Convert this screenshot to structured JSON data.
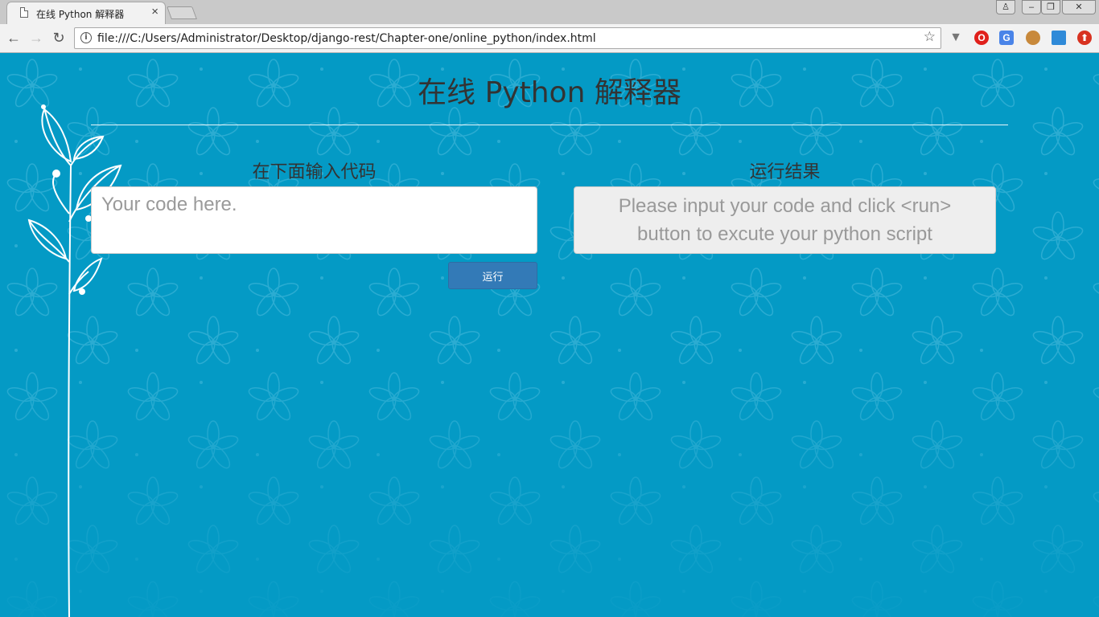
{
  "browser": {
    "tab_title": "在线 Python 解释器",
    "tab_close": "×",
    "url": "file:///C:/Users/Administrator/Desktop/django-rest/Chapter-one/online_python/index.html",
    "info_glyph": "i",
    "star_glyph": "☆",
    "back_glyph": "←",
    "forward_glyph": "→",
    "reload_glyph": "↻",
    "win_min": "–",
    "win_max": "❐",
    "win_close": "✕",
    "user_glyph": "♙"
  },
  "extensions": [
    "vivaldi-icon",
    "opera-icon",
    "translate-icon",
    "cookie-icon",
    "window-icon",
    "addon-icon"
  ],
  "page": {
    "heading": "在线 Python 解释器",
    "code_heading": "在下面输入代码",
    "result_heading": "运行结果",
    "code_placeholder": "Your code here.",
    "code_value": "",
    "result_text": "Please input your code and click <run> button to excute your python script",
    "run_label": "运行"
  },
  "colors": {
    "background": "#049ac5",
    "button": "#337ab7"
  }
}
